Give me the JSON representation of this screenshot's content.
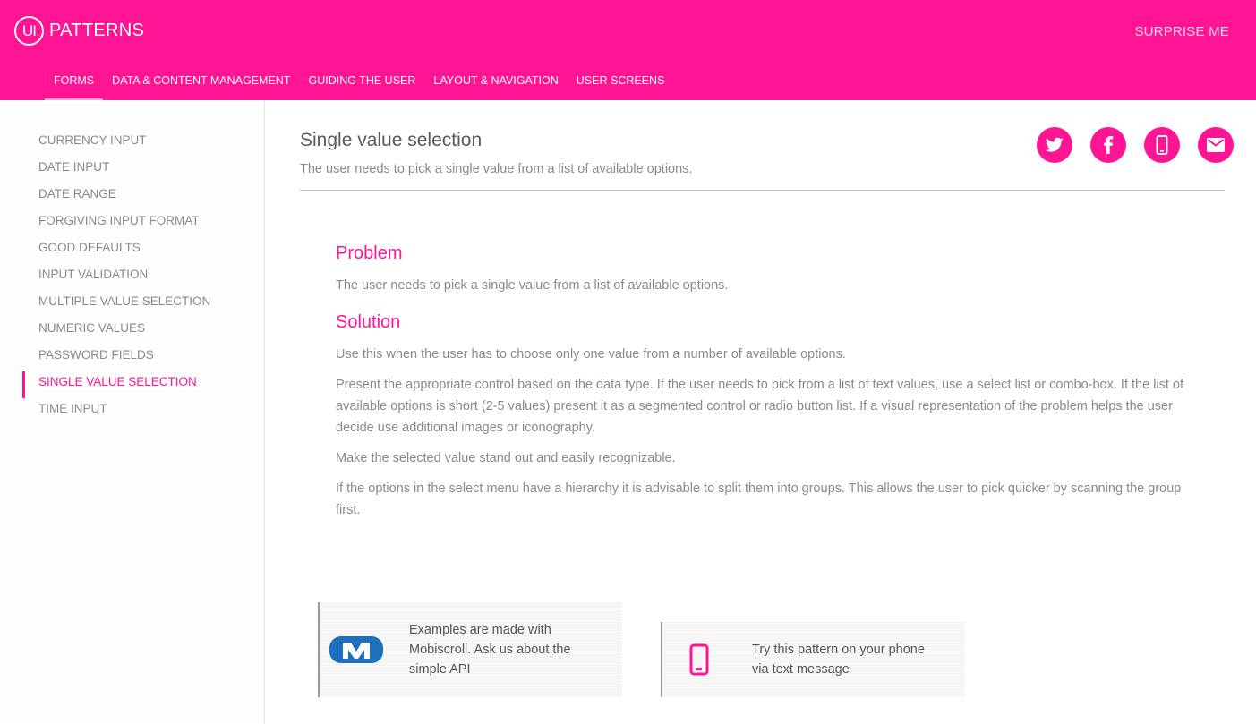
{
  "header": {
    "logo_mark": "UI",
    "logo_text": "PATTERNS",
    "surprise_label": "SURPRISE ME",
    "nav": [
      "FORMS",
      "DATA & CONTENT MANAGEMENT",
      "GUIDING THE USER",
      "LAYOUT & NAVIGATION",
      "USER SCREENS"
    ],
    "active_nav": "FORMS"
  },
  "sidebar": {
    "items": [
      "CURRENCY INPUT",
      "DATE INPUT",
      "DATE RANGE",
      "FORGIVING INPUT FORMAT",
      "GOOD DEFAULTS",
      "INPUT VALIDATION",
      "MULTIPLE VALUE SELECTION",
      "NUMERIC VALUES",
      "PASSWORD FIELDS",
      "SINGLE VALUE SELECTION",
      "TIME INPUT"
    ],
    "active": "SINGLE VALUE SELECTION"
  },
  "page": {
    "title": "Single value selection",
    "subtitle": "The user needs to pick a single value from a list of available options."
  },
  "share_icons": [
    "twitter-icon",
    "facebook-icon",
    "phone-icon",
    "email-icon"
  ],
  "problem": {
    "heading": "Problem",
    "text": "The user needs to pick a single value from a list of available options."
  },
  "solution": {
    "heading": "Solution",
    "paragraphs": [
      "Use this when the user has to choose only one value from a number of available options.",
      "Present the appropriate control based on the data type. If the user needs to pick from a list of text values, use a select list or combo-box. If the list of available options is short (2-5 values) present it as a segmented control or radio button list. If a visual representation of the problem helps the user decide use additional images or iconography.",
      "Make the selected value stand out and easily recognizable.",
      "If the options in the select menu have a hierarchy it is advisable to split them into groups. This allows the user to pick quicker by scanning the group first."
    ]
  },
  "cards": {
    "mobiscroll": "Examples are made with Mobiscroll. Ask us about the simple API",
    "phone": "Try this pattern on your phone via text message"
  },
  "colors": {
    "brand": "#ff1493",
    "text": "#8a8a8a",
    "heading": "#5a5a5a"
  }
}
